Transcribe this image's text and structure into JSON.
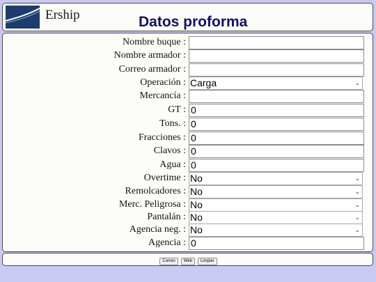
{
  "header": {
    "brand": "Ership",
    "title": "Datos proforma"
  },
  "form": {
    "fields": [
      {
        "label": "Nombre buque :",
        "type": "text",
        "value": ""
      },
      {
        "label": "Nombre armador :",
        "type": "text",
        "value": ""
      },
      {
        "label": "Correo armador :",
        "type": "text",
        "value": ""
      },
      {
        "label": "Operación :",
        "type": "select",
        "value": "Carga"
      },
      {
        "label": "Mercancía :",
        "type": "text",
        "value": ""
      },
      {
        "label": "GT :",
        "type": "text",
        "value": "0"
      },
      {
        "label": "Tons. :",
        "type": "text",
        "value": "0"
      },
      {
        "label": "Fracciones :",
        "type": "text",
        "value": "0"
      },
      {
        "label": "Clavos :",
        "type": "text",
        "value": "0"
      },
      {
        "label": "Agua :",
        "type": "text",
        "value": "0"
      },
      {
        "label": "Overtime :",
        "type": "select",
        "value": "No"
      },
      {
        "label": "Remolcadores :",
        "type": "select",
        "value": "No"
      },
      {
        "label": "Merc. Peligrosa :",
        "type": "select",
        "value": "No"
      },
      {
        "label": "Pantalán :",
        "type": "select",
        "value": "No"
      },
      {
        "label": "Agencia neg. :",
        "type": "select",
        "value": "No"
      },
      {
        "label": "Agencia :",
        "type": "text",
        "value": "0"
      }
    ]
  },
  "footer": {
    "buttons": [
      "Correo",
      "Web",
      "Limpiar"
    ]
  },
  "icons": {
    "logo": "ership-logo-icon",
    "dropdown": "chevron-down-icon"
  },
  "colors": {
    "background": "#c9c9f3",
    "panel": "#fcfcf8",
    "title": "#10106a",
    "logo": "#1f3c6e"
  }
}
